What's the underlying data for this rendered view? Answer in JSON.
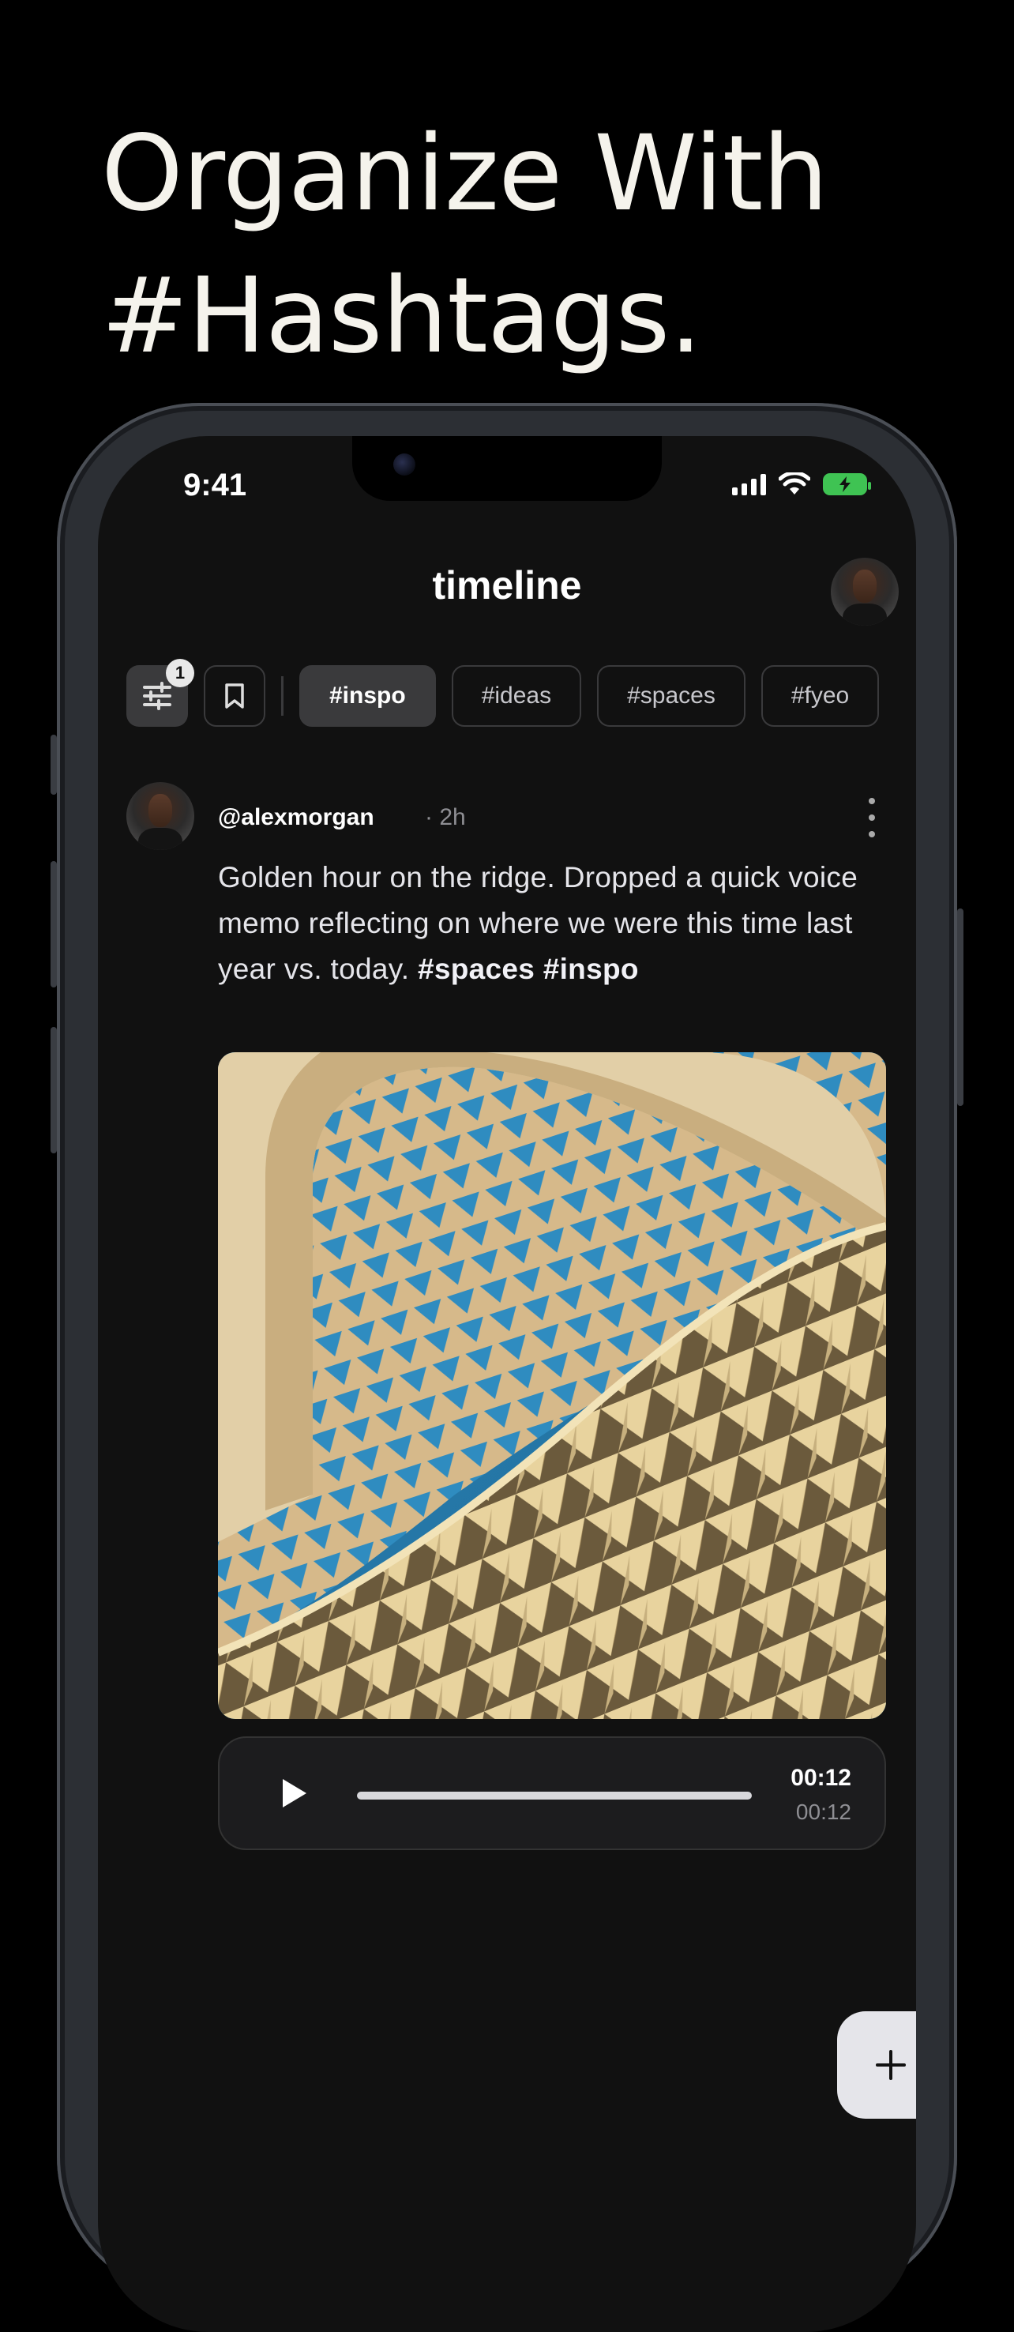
{
  "headline": {
    "line1": "Organize With",
    "line2": "#Hashtags."
  },
  "status_bar": {
    "time": "9:41"
  },
  "nav": {
    "title": "timeline"
  },
  "filters": {
    "filter_badge": "1",
    "chips": [
      "#inspo",
      "#ideas",
      "#spaces",
      "#fyeo"
    ],
    "active_chip": "#inspo"
  },
  "post": {
    "username": "@alexmorgan",
    "time": "· 2h",
    "text": "Golden hour on the ridge. Dropped a quick voice memo reflecting on where we were this time last year vs. today. ",
    "tag1": "#spaces",
    "tag2": "#inspo",
    "image_description_icon": "architecture-photo",
    "audio": {
      "duration": "00:12",
      "elapsed": "00:12",
      "progress": 1.0
    }
  },
  "fab": {
    "icon": "plus-icon"
  },
  "colors": {
    "accent_battery": "#3fc353",
    "background": "#111111"
  }
}
